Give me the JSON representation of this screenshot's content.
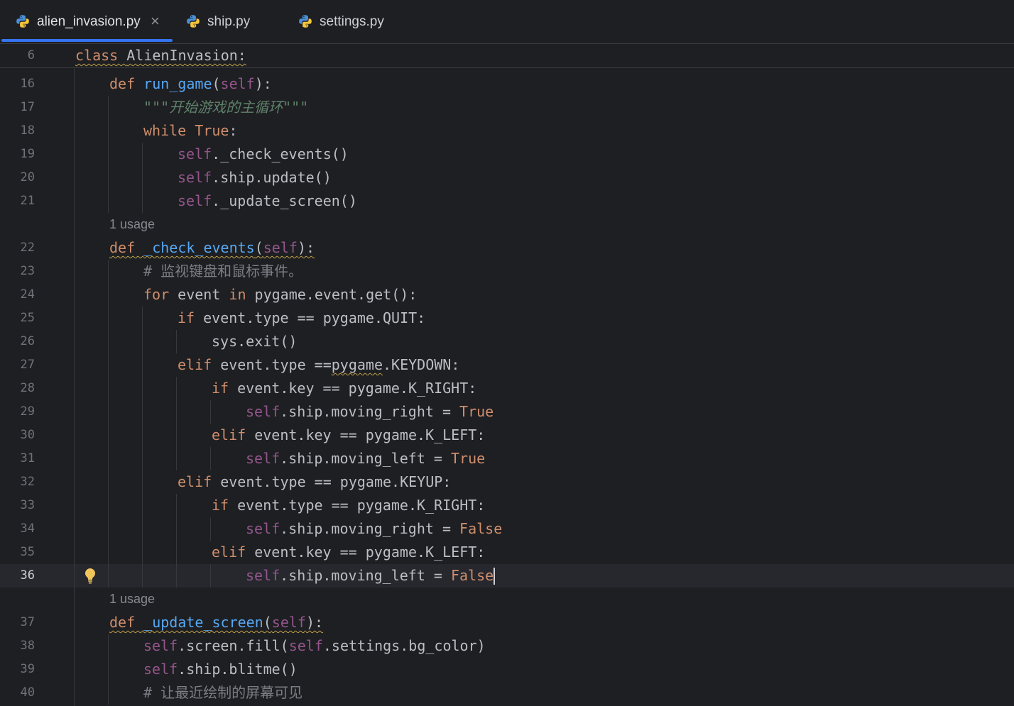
{
  "tabs": [
    {
      "label": "alien_invasion.py",
      "icon": "python-file-icon",
      "active": true,
      "close_glyph": "×"
    },
    {
      "label": "ship.py",
      "icon": "python-file-icon",
      "active": false
    },
    {
      "label": "settings.py",
      "icon": "python-file-icon",
      "active": false
    }
  ],
  "sticky": {
    "number": "6",
    "indent": 0,
    "tokens": [
      {
        "k": "keyword",
        "t": "class ",
        "w": true
      },
      {
        "k": "plain",
        "t": "AlienInvasion:",
        "w": true
      }
    ]
  },
  "lines": [
    {
      "number": "16",
      "indent": 1,
      "tokens": [
        {
          "k": "keyword",
          "t": "def "
        },
        {
          "k": "function",
          "t": "run_game"
        },
        {
          "k": "plain",
          "t": "("
        },
        {
          "k": "self",
          "t": "self"
        },
        {
          "k": "plain",
          "t": "):"
        }
      ]
    },
    {
      "number": "17",
      "indent": 2,
      "tokens": [
        {
          "k": "docstring",
          "t": "\"\"\"开始游戏的主循环\"\"\""
        }
      ]
    },
    {
      "number": "18",
      "indent": 2,
      "tokens": [
        {
          "k": "keyword",
          "t": "while "
        },
        {
          "k": "constant",
          "t": "True"
        },
        {
          "k": "plain",
          "t": ":"
        }
      ]
    },
    {
      "number": "19",
      "indent": 3,
      "tokens": [
        {
          "k": "self",
          "t": "self"
        },
        {
          "k": "plain",
          "t": "._check_events()"
        }
      ]
    },
    {
      "number": "20",
      "indent": 3,
      "tokens": [
        {
          "k": "self",
          "t": "self"
        },
        {
          "k": "plain",
          "t": ".ship.update()"
        }
      ]
    },
    {
      "number": "21",
      "indent": 3,
      "tokens": [
        {
          "k": "self",
          "t": "self"
        },
        {
          "k": "plain",
          "t": "._update_screen()"
        }
      ]
    },
    {
      "usage": "1 usage"
    },
    {
      "number": "22",
      "indent": 1,
      "tokens": [
        {
          "k": "keyword",
          "t": "def ",
          "w": true
        },
        {
          "k": "function",
          "t": "_check_events",
          "w": true
        },
        {
          "k": "plain",
          "t": "(",
          "w": true
        },
        {
          "k": "self",
          "t": "self",
          "w": true
        },
        {
          "k": "plain",
          "t": "):",
          "w": true
        }
      ]
    },
    {
      "number": "23",
      "indent": 2,
      "tokens": [
        {
          "k": "comment",
          "t": "# 监视键盘和鼠标事件。"
        }
      ]
    },
    {
      "number": "24",
      "indent": 2,
      "tokens": [
        {
          "k": "keyword",
          "t": "for "
        },
        {
          "k": "plain",
          "t": "event "
        },
        {
          "k": "keyword",
          "t": "in "
        },
        {
          "k": "plain",
          "t": "pygame.event.get():"
        }
      ]
    },
    {
      "number": "25",
      "indent": 3,
      "tokens": [
        {
          "k": "keyword",
          "t": "if "
        },
        {
          "k": "plain",
          "t": "event.type == pygame.QUIT:"
        }
      ]
    },
    {
      "number": "26",
      "indent": 4,
      "tokens": [
        {
          "k": "plain",
          "t": "sys.exit()"
        }
      ]
    },
    {
      "number": "27",
      "indent": 3,
      "tokens": [
        {
          "k": "keyword",
          "t": "elif "
        },
        {
          "k": "plain",
          "t": "event.type =="
        },
        {
          "k": "plain",
          "t": "pygame",
          "w": true
        },
        {
          "k": "plain",
          "t": ".KEYDOWN:"
        }
      ]
    },
    {
      "number": "28",
      "indent": 4,
      "tokens": [
        {
          "k": "keyword",
          "t": "if "
        },
        {
          "k": "plain",
          "t": "event.key == pygame.K_RIGHT:"
        }
      ]
    },
    {
      "number": "29",
      "indent": 5,
      "tokens": [
        {
          "k": "self",
          "t": "self"
        },
        {
          "k": "plain",
          "t": ".ship.moving_right = "
        },
        {
          "k": "constant",
          "t": "True"
        }
      ]
    },
    {
      "number": "30",
      "indent": 4,
      "tokens": [
        {
          "k": "keyword",
          "t": "elif "
        },
        {
          "k": "plain",
          "t": "event.key == pygame.K_LEFT:"
        }
      ]
    },
    {
      "number": "31",
      "indent": 5,
      "tokens": [
        {
          "k": "self",
          "t": "self"
        },
        {
          "k": "plain",
          "t": ".ship.moving_left = "
        },
        {
          "k": "constant",
          "t": "True"
        }
      ]
    },
    {
      "number": "32",
      "indent": 3,
      "tokens": [
        {
          "k": "keyword",
          "t": "elif "
        },
        {
          "k": "plain",
          "t": "event.type == pygame.KEYUP:"
        }
      ]
    },
    {
      "number": "33",
      "indent": 4,
      "tokens": [
        {
          "k": "keyword",
          "t": "if "
        },
        {
          "k": "plain",
          "t": "event.type == pygame.K_RIGHT:"
        }
      ]
    },
    {
      "number": "34",
      "indent": 5,
      "tokens": [
        {
          "k": "self",
          "t": "self"
        },
        {
          "k": "plain",
          "t": ".ship.moving_right = "
        },
        {
          "k": "constant",
          "t": "False"
        }
      ]
    },
    {
      "number": "35",
      "indent": 4,
      "tokens": [
        {
          "k": "keyword",
          "t": "elif "
        },
        {
          "k": "plain",
          "t": "event.key == pygame.K_LEFT:"
        }
      ]
    },
    {
      "number": "36",
      "indent": 5,
      "current": true,
      "intention_icon": "lightbulb-icon",
      "tokens": [
        {
          "k": "self",
          "t": "self"
        },
        {
          "k": "plain",
          "t": ".ship.moving_left = "
        },
        {
          "k": "constant",
          "t": "False"
        }
      ]
    },
    {
      "usage": "1 usage"
    },
    {
      "number": "37",
      "indent": 1,
      "tokens": [
        {
          "k": "keyword",
          "t": "def ",
          "w": true
        },
        {
          "k": "function",
          "t": "_update_screen",
          "w": true
        },
        {
          "k": "plain",
          "t": "(",
          "w": true
        },
        {
          "k": "self",
          "t": "self",
          "w": true
        },
        {
          "k": "plain",
          "t": "):",
          "w": true
        }
      ]
    },
    {
      "number": "38",
      "indent": 2,
      "tokens": [
        {
          "k": "self",
          "t": "self"
        },
        {
          "k": "plain",
          "t": ".screen.fill("
        },
        {
          "k": "self",
          "t": "self"
        },
        {
          "k": "plain",
          "t": ".settings.bg_color)"
        }
      ]
    },
    {
      "number": "39",
      "indent": 2,
      "tokens": [
        {
          "k": "self",
          "t": "self"
        },
        {
          "k": "plain",
          "t": ".ship.blitme()"
        }
      ]
    },
    {
      "number": "40",
      "indent": 2,
      "tokens": [
        {
          "k": "comment",
          "t": "# 让最近绘制的屏幕可见"
        }
      ]
    }
  ],
  "colors": {
    "bg": "#1e1f22",
    "border": "#393b40",
    "accent": "#3574f0",
    "gutter": "#6f737a",
    "gutter_current": "#d0d2d6",
    "current_line": "#26282e",
    "guide": "#35383d",
    "warn": "#bfa14a",
    "hint": "#868a91",
    "tab_active": "#dfe1e5",
    "tab_inactive": "#cdd0d5",
    "close": "#8c8f94",
    "caret": "#ced0d6",
    "keyword": "#cf8e6d",
    "constant": "#cf8e6d",
    "function": "#56a8f5",
    "self": "#94558d",
    "plain": "#bcbec4",
    "docstring": "#5f826b",
    "comment": "#7a7e85",
    "python_blue": "#4a8fd8",
    "python_yellow": "#f5c53b",
    "bulb": "#f2c55c"
  }
}
